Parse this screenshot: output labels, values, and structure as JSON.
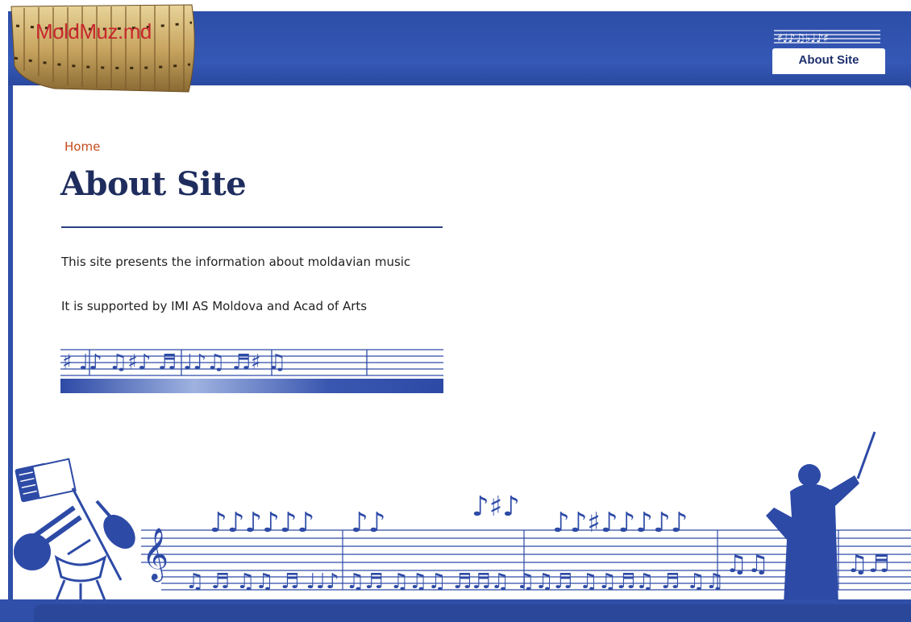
{
  "site": {
    "logo_text": "MoldMuz.md"
  },
  "nav": {
    "tabs": [
      {
        "label": "About Site",
        "active": true
      }
    ]
  },
  "breadcrumb": {
    "home_label": "Home"
  },
  "page": {
    "title": "About Site",
    "paragraphs": [
      "This site presents the information about moldavian music",
      "It is supported by IMI AS Moldova and Acad of Arts"
    ]
  },
  "colors": {
    "frame_blue": "#2f4fa8",
    "title_navy": "#1f2d5e",
    "breadcrumb_orange": "#c64a1a",
    "logo_red": "#c8282e"
  },
  "icons": [
    "pan-flute-logo",
    "music-staff-icon",
    "accordion-icon",
    "trombone-icon",
    "violin-icon",
    "drum-icon",
    "conductor-silhouette"
  ]
}
